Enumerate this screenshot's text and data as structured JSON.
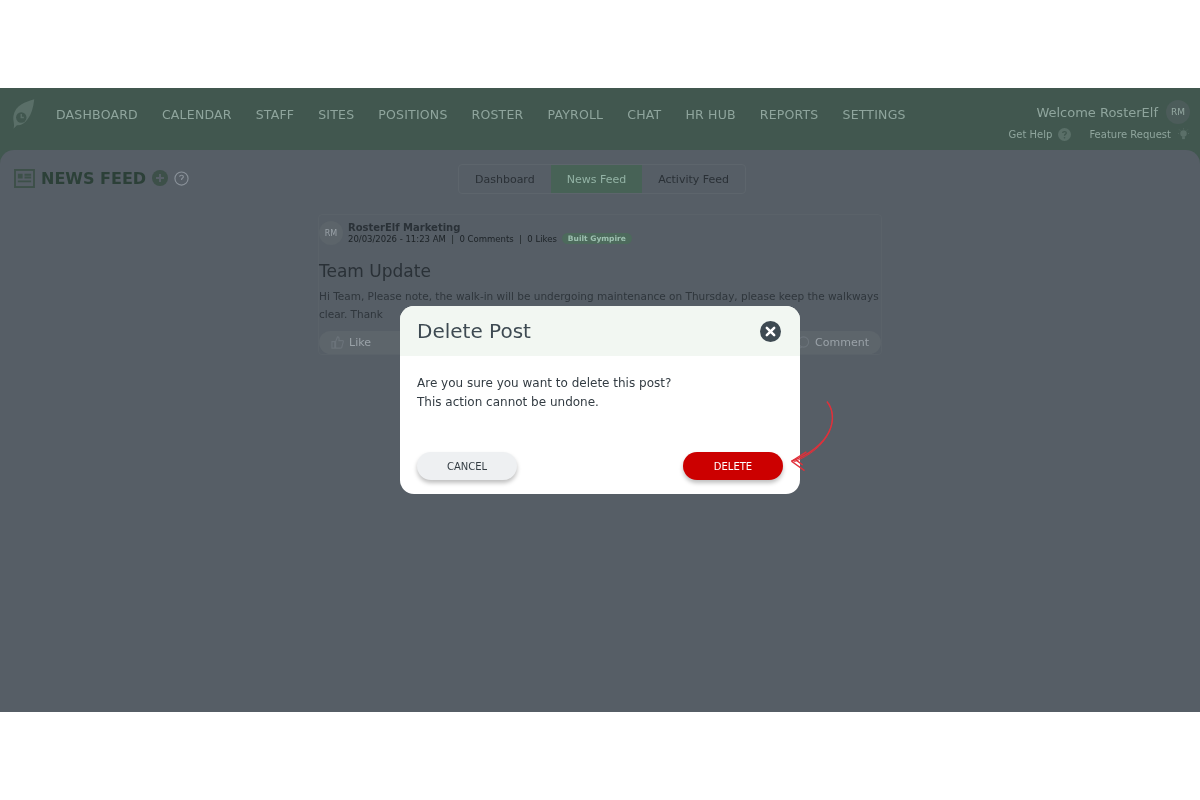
{
  "nav": {
    "items": [
      {
        "label": "DASHBOARD",
        "selected": false
      },
      {
        "label": "CALENDAR",
        "selected": false
      },
      {
        "label": "STAFF",
        "selected": false
      },
      {
        "label": "SITES",
        "selected": false
      },
      {
        "label": "POSITIONS",
        "selected": false
      },
      {
        "label": "ROSTER",
        "selected": false
      },
      {
        "label": "PAYROLL",
        "selected": false
      },
      {
        "label": "CHAT",
        "selected": false
      },
      {
        "label": "HR HUB",
        "selected": false
      },
      {
        "label": "REPORTS",
        "selected": false
      },
      {
        "label": "SETTINGS",
        "selected": false
      }
    ],
    "welcome": "Welcome RosterElf",
    "avatar": "RM",
    "help": "Get Help",
    "feature": "Feature Request"
  },
  "page": {
    "title": "NEWS FEED",
    "tabs": [
      {
        "label": "Dashboard",
        "selected": false
      },
      {
        "label": "News Feed",
        "selected": true
      },
      {
        "label": "Activity Feed",
        "selected": false
      }
    ]
  },
  "post": {
    "avatar": "RM",
    "author": "RosterElf Marketing",
    "meta": "20/03/2026 - 11:23 AM  |  0 Comments  |  0 Likes",
    "tag": "Built Gympire",
    "title": "Team Update",
    "body": "Hi Team, Please note, the walk-in will be undergoing maintenance on Thursday, please keep the walkways clear. Thank",
    "like": "Like",
    "comment": "Comment"
  },
  "dialog": {
    "title": "Delete Post",
    "message": [
      "Are you sure you want to delete this post?",
      "This action cannot be undone."
    ],
    "cancel": "CANCEL",
    "confirm": "DELETE"
  }
}
